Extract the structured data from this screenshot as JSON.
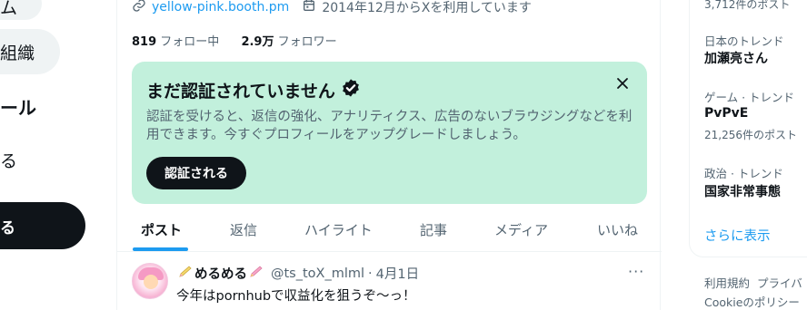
{
  "nav": {
    "top_item_label": "ム",
    "org_label": "組織",
    "profile_label": "ール",
    "more_label": "る",
    "post_button_label": "る"
  },
  "profile": {
    "website": "yellow-pink.booth.pm",
    "joined": "2014年12月からXを利用しています",
    "following_count": "819",
    "following_label": "フォロー中",
    "followers_count": "2.9万",
    "followers_label": "フォロワー"
  },
  "verify_card": {
    "title": "まだ認証されていません",
    "body": "認証を受けると、返信の強化、アナリティクス、広告のないブラウジングなどを利用できます。今すぐプロフィールをアップグレードしましょう。",
    "button_label": "認証される",
    "background": "#c2f0dc"
  },
  "tabs": [
    {
      "label": "ポスト",
      "active": true
    },
    {
      "label": "返信",
      "active": false
    },
    {
      "label": "ハイライト",
      "active": false
    },
    {
      "label": "記事",
      "active": false
    },
    {
      "label": "メディア",
      "active": false
    },
    {
      "label": "いいね",
      "active": false
    }
  ],
  "tweet": {
    "name": "めるめる",
    "handle": "@ts_toX_mlml",
    "date": "4月1日",
    "text": "今年はpornhubで収益化を狙うぞ〜っ！",
    "more_label": "···"
  },
  "trends": {
    "top_count": "3,712件のポスト",
    "items": [
      {
        "category": "日本のトレンド",
        "name": "加瀬亮さん",
        "count": ""
      },
      {
        "category": "ゲーム · トレンド",
        "name": "PvPvE",
        "count": "21,256件のポスト"
      },
      {
        "category": "政治 · トレンド",
        "name": "国家非常事態",
        "count": ""
      }
    ],
    "show_more": "さらに表示"
  },
  "footer": {
    "terms": "利用規約",
    "privacy": "プライバ",
    "cookie": "Cookieのポリシー"
  },
  "colors": {
    "accent": "#1d9bf0",
    "text": "#0f1419",
    "muted": "#536471"
  },
  "icons": [
    "link-icon",
    "calendar-icon",
    "verified-badge-icon",
    "close-icon",
    "more-icon",
    "pencil-icon"
  ]
}
